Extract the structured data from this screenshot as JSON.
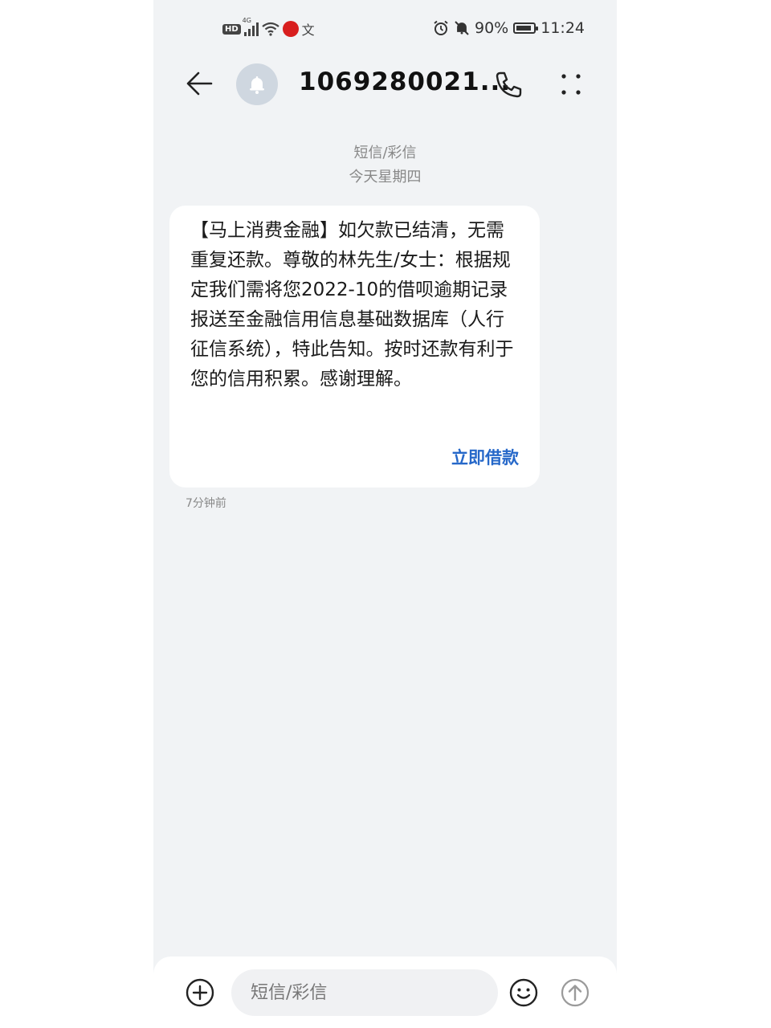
{
  "status_bar": {
    "hd": "HD",
    "network": "4G",
    "app_badge": "",
    "misc_glyph": "文",
    "battery_percent": "90%",
    "battery_level": 0.9,
    "time": "11:24",
    "icons": [
      "signal-icon",
      "wifi-icon",
      "alarm-icon",
      "mute-bell-icon",
      "battery-icon"
    ]
  },
  "header": {
    "contact": "1069280021...",
    "back_icon": "arrow-left-icon",
    "avatar_icon": "bell-icon",
    "call_icon": "phone-icon",
    "more_icon": "more-vertical-icon"
  },
  "conversation": {
    "message_type": "短信/彩信",
    "date": "今天星期四"
  },
  "message": {
    "text": "【马上消费金融】如欠款已结清，无需重复还款。尊敬的林先生/女士：根据规定我们需将您2022-10的借呗逾期记录报送至金融信用信息基础数据库（人行征信系统），特此告知。按时还款有利于您的信用积累。感谢理解。",
    "action_label": "立即借款",
    "time": "7分钟前"
  },
  "input_bar": {
    "placeholder": "短信/彩信",
    "add_icon": "add-circle-icon",
    "emoji_icon": "emoji-icon",
    "send_icon": "send-icon"
  },
  "colors": {
    "background": "#f1f3f5",
    "bubble": "#ffffff",
    "action": "#2668c9"
  }
}
